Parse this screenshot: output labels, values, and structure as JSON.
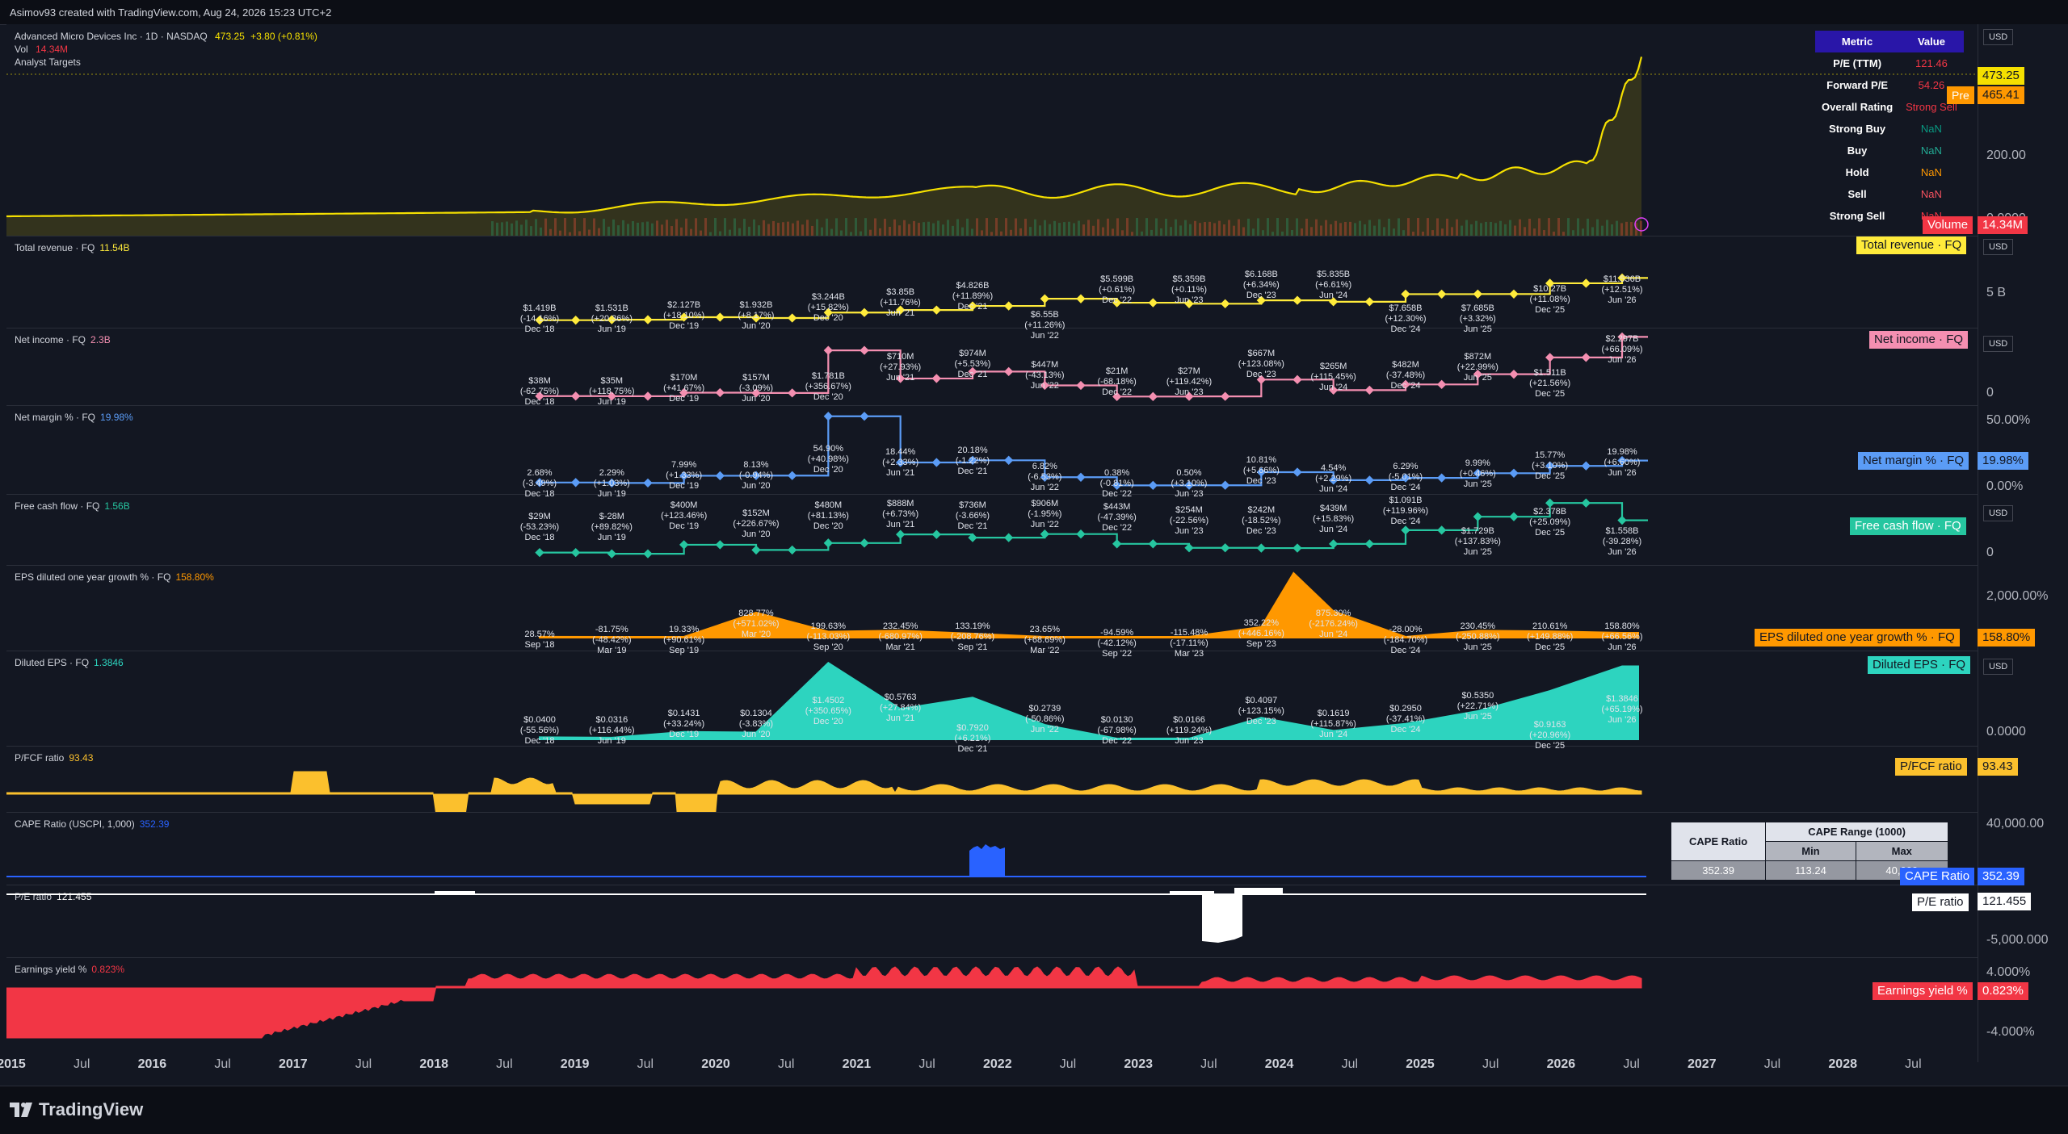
{
  "header": {
    "created_by": "Asimov93 created with TradingView.com, Aug 24, 2026 15:23 UTC+2",
    "symbol_line": "Advanced Micro Devices Inc · 1D · NASDAQ",
    "last": "473.25",
    "change": "+3.80 (+0.81%)",
    "vol_label": "Vol",
    "vol_value": "14.34M",
    "analyst": "Analyst Targets"
  },
  "metric_table": {
    "head": [
      "Metric",
      "Value"
    ],
    "rows": [
      {
        "k": "P/E (TTM)",
        "v": "121.46",
        "color": "#f23645"
      },
      {
        "k": "Forward P/E",
        "v": "54.26",
        "color": "#f23645"
      },
      {
        "k": "Overall Rating",
        "v": "Strong Sell",
        "color": "#f23645"
      },
      {
        "k": "Strong Buy",
        "v": "NaN",
        "color": "#089981"
      },
      {
        "k": "Buy",
        "v": "NaN",
        "color": "#22ab94"
      },
      {
        "k": "Hold",
        "v": "NaN",
        "color": "#ff9800"
      },
      {
        "k": "Sell",
        "v": "NaN",
        "color": "#f7525f"
      },
      {
        "k": "Strong Sell",
        "v": "NaN",
        "color": "#f23645"
      }
    ]
  },
  "cape_table": {
    "title": "CAPE Ratio",
    "range_title": "CAPE Range (1000)",
    "min_label": "Min",
    "max_label": "Max",
    "value": "352.39",
    "min": "113.24",
    "max": "40,000"
  },
  "colors": {
    "price": "#f5e000",
    "revenue": "#ffeb3b",
    "income": "#f48fb1",
    "margin": "#5b9cf6",
    "fcf": "#26c6a0",
    "eps_growth": "#ff9800",
    "diluted": "#2dd4bf",
    "pfcf": "#fbc02d",
    "cape": "#2962ff",
    "pe": "#ffffff",
    "ey": "#f23645"
  },
  "price_pane": {
    "usd": "USD",
    "scale": [
      "200.00",
      "0.0000"
    ],
    "last_tag": "473.25",
    "pre_label": "Pre",
    "pre_value": "465.41",
    "volume_label": "Volume",
    "volume_value": "14.34M"
  },
  "panes": {
    "revenue": {
      "title": "Total revenue · FQ",
      "value": "11.54B",
      "tag": "Total revenue · FQ",
      "usd": "USD",
      "scale": "5 B"
    },
    "income": {
      "title": "Net income · FQ",
      "value": "2.3B",
      "tag": "Net income · FQ",
      "usd": "USD",
      "scale": "0"
    },
    "margin": {
      "title": "Net margin % · FQ",
      "value": "19.98%",
      "tag": "Net margin % · FQ",
      "tag_value": "19.98%",
      "scale": [
        "50.00%",
        "0.00%"
      ]
    },
    "fcf": {
      "title": "Free cash flow · FQ",
      "value": "1.56B",
      "tag": "Free cash flow · FQ",
      "usd": "USD",
      "scale": "0"
    },
    "eps_growth": {
      "title": "EPS diluted one year growth % · FQ",
      "value": "158.80%",
      "tag": "EPS diluted one year growth % · FQ",
      "tag_value": "158.80%",
      "scale": "2,000.00%"
    },
    "diluted": {
      "title": "Diluted EPS · FQ",
      "value": "1.3846",
      "tag": "Diluted EPS · FQ",
      "usd": "USD",
      "scale": "0.0000"
    },
    "pfcf": {
      "title": "P/FCF ratio",
      "value": "93.43",
      "tag": "P/FCF ratio",
      "tag_value": "93.43"
    },
    "cape": {
      "title": "CAPE Ratio (USCPI, 1,000)",
      "value": "352.39",
      "tag": "CAPE Ratio",
      "tag_value": "352.39",
      "scale": "40,000.00"
    },
    "pe": {
      "title": "P/E ratio",
      "value": "121.455",
      "tag": "P/E ratio",
      "tag_value": "121.455",
      "scale": "-5,000.000"
    },
    "ey": {
      "title": "Earnings yield %",
      "value": "0.823%",
      "tag": "Earnings yield %",
      "tag_value": "0.823%",
      "scale": [
        "4.000%",
        "-4.000%"
      ]
    }
  },
  "revenue_ann": [
    [
      "$1.419B",
      "(-14.16%)",
      "Dec '18"
    ],
    [
      "$1.531B",
      "(+20.36%)",
      "Jun '19"
    ],
    [
      "$2.127B",
      "(+18.10%)",
      "Dec '19"
    ],
    [
      "$1.932B",
      "(+8.17%)",
      "Jun '20"
    ],
    [
      "$3.244B",
      "(+15.82%)",
      "Dec '20"
    ],
    [
      "$3.85B",
      "(+11.76%)",
      "Jun '21"
    ],
    [
      "$4.826B",
      "(+11.89%)",
      "Dec '21"
    ],
    [
      "$6.55B",
      "(+11.26%)",
      "Jun '22"
    ],
    [
      "$5.599B",
      "(+0.61%)",
      "Dec '22"
    ],
    [
      "$5.359B",
      "(+0.11%)",
      "Jun '23"
    ],
    [
      "$6.168B",
      "(+6.34%)",
      "Dec '23"
    ],
    [
      "$5.835B",
      "(+6.61%)",
      "Jun '24"
    ],
    [
      "$7.658B",
      "(+12.30%)",
      "Dec '24"
    ],
    [
      "$7.685B",
      "(+3.32%)",
      "Jun '25"
    ],
    [
      "$10.27B",
      "(+11.08%)",
      "Dec '25"
    ],
    [
      "$11.536B",
      "(+12.51%)",
      "Jun '26"
    ]
  ],
  "income_ann": [
    [
      "$38M",
      "(-62.75%)",
      "Dec '18"
    ],
    [
      "$35M",
      "(+118.75%)",
      "Jun '19"
    ],
    [
      "$170M",
      "(+41.67%)",
      "Dec '19"
    ],
    [
      "$157M",
      "(-3.09%)",
      "Jun '20"
    ],
    [
      "$1.781B",
      "(+356.67%)",
      "Dec '20"
    ],
    [
      "$710M",
      "(+27.93%)",
      "Jun '21"
    ],
    [
      "$974M",
      "(+5.53%)",
      "Dec '21"
    ],
    [
      "$447M",
      "(-43.13%)",
      "Jun '22"
    ],
    [
      "$21M",
      "(-68.18%)",
      "Dec '22"
    ],
    [
      "$27M",
      "(+119.42%)",
      "Jun '23"
    ],
    [
      "$667M",
      "(+123.08%)",
      "Dec '23"
    ],
    [
      "$265M",
      "(+115.45%)",
      "Jun '24"
    ],
    [
      "$482M",
      "(-37.48%)",
      "Dec '24"
    ],
    [
      "$872M",
      "(+22.99%)",
      "Jun '25"
    ],
    [
      "$1.511B",
      "(+21.56%)",
      "Dec '25"
    ],
    [
      "$2.297B",
      "(+66.09%)",
      "Jun '26"
    ]
  ],
  "margin_ann": [
    [
      "2.68%",
      "(-3.49%)",
      "Dec '18"
    ],
    [
      "2.29%",
      "(+1.03%)",
      "Jun '19"
    ],
    [
      "7.99%",
      "(+1.33%)",
      "Dec '19"
    ],
    [
      "8.13%",
      "(-0.94%)",
      "Jun '20"
    ],
    [
      "54.90%",
      "(+40.98%)",
      "Dec '20"
    ],
    [
      "18.44%",
      "(+2.33%)",
      "Jun '21"
    ],
    [
      "20.18%",
      "(-1.22%)",
      "Dec '21"
    ],
    [
      "6.82%",
      "(-6.53%)",
      "Jun '22"
    ],
    [
      "0.38%",
      "(-0.81%)",
      "Dec '22"
    ],
    [
      "0.50%",
      "(+3.10%)",
      "Jun '23"
    ],
    [
      "10.81%",
      "(+5.66%)",
      "Dec '23"
    ],
    [
      "4.54%",
      "(+2.29%)",
      "Jun '24"
    ],
    [
      "6.29%",
      "(-5.01%)",
      "Dec '24"
    ],
    [
      "9.99%",
      "(+0.46%)",
      "Jun '25"
    ],
    [
      "15.77%",
      "(+3.10%)",
      "Dec '25"
    ],
    [
      "19.98%",
      "(+6.60%)",
      "Jun '26"
    ]
  ],
  "fcf_ann": [
    [
      "$29M",
      "(-53.23%)",
      "Dec '18"
    ],
    [
      "$-28M",
      "(+89.82%)",
      "Jun '19"
    ],
    [
      "$400M",
      "(+123.46%)",
      "Dec '19"
    ],
    [
      "$152M",
      "(+226.67%)",
      "Jun '20"
    ],
    [
      "$480M",
      "(+81.13%)",
      "Dec '20"
    ],
    [
      "$888M",
      "(+6.73%)",
      "Jun '21"
    ],
    [
      "$736M",
      "(-3.66%)",
      "Dec '21"
    ],
    [
      "$906M",
      "(-1.95%)",
      "Jun '22"
    ],
    [
      "$443M",
      "(-47.39%)",
      "Dec '22"
    ],
    [
      "$254M",
      "(-22.56%)",
      "Jun '23"
    ],
    [
      "$242M",
      "(-18.52%)",
      "Dec '23"
    ],
    [
      "$439M",
      "(+15.83%)",
      "Jun '24"
    ],
    [
      "$1.091B",
      "(+119.96%)",
      "Dec '24"
    ],
    [
      "$1.729B",
      "(+137.83%)",
      "Jun '25"
    ],
    [
      "$2.378B",
      "(+25.09%)",
      "Dec '25"
    ],
    [
      "$1.558B",
      "(-39.28%)",
      "Jun '26"
    ]
  ],
  "eps_growth_ann": [
    [
      "28.57%",
      "",
      "Sep '18"
    ],
    [
      "-81.75%",
      "(-48.42%)",
      "Mar '19"
    ],
    [
      "19.33%",
      "(+90.61%)",
      "Sep '19"
    ],
    [
      "828.77%",
      "(+571.02%)",
      "Mar '20"
    ],
    [
      "199.63%",
      "(-113.03%)",
      "Sep '20"
    ],
    [
      "232.45%",
      "(-680.97%)",
      "Mar '21"
    ],
    [
      "133.19%",
      "(-208.76%)",
      "Sep '21"
    ],
    [
      "23.65%",
      "(+68.69%)",
      "Mar '22"
    ],
    [
      "-94.59%",
      "(-42.12%)",
      "Sep '22"
    ],
    [
      "-115.48%",
      "(-17.11%)",
      "Mar '23"
    ],
    [
      "352.22%",
      "(+446.16%)",
      "Sep '23"
    ],
    [
      "875.30%",
      "(-2176.24%)",
      "Jun '24"
    ],
    [
      "-28.00%",
      "(-184.70%)",
      "Dec '24"
    ],
    [
      "230.45%",
      "(-250.88%)",
      "Jun '25"
    ],
    [
      "210.61%",
      "(+149.88%)",
      "Dec '25"
    ],
    [
      "158.80%",
      "(+66.56%)",
      "Jun '26"
    ]
  ],
  "diluted_ann": [
    [
      "$0.0400",
      "(-55.56%)",
      "Dec '18"
    ],
    [
      "$0.0316",
      "(+116.44%)",
      "Jun '19"
    ],
    [
      "$0.1431",
      "(+33.24%)",
      "Dec '19"
    ],
    [
      "$0.1304",
      "(-3.83%)",
      "Jun '20"
    ],
    [
      "$1.4502",
      "(+350.65%)",
      "Dec '20"
    ],
    [
      "$0.5763",
      "(+27.84%)",
      "Jun '21"
    ],
    [
      "$0.7920",
      "(+6.21%)",
      "Dec '21"
    ],
    [
      "$0.2739",
      "(-50.86%)",
      "Jun '22"
    ],
    [
      "$0.0130",
      "(-67.98%)",
      "Dec '22"
    ],
    [
      "$0.0166",
      "(+119.24%)",
      "Jun '23"
    ],
    [
      "$0.4097",
      "(+123.15%)",
      "Dec '23"
    ],
    [
      "$0.1619",
      "(+115.87%)",
      "Jun '24"
    ],
    [
      "$0.2950",
      "(-37.41%)",
      "Dec '24"
    ],
    [
      "$0.5350",
      "(+22.71%)",
      "Jun '25"
    ],
    [
      "$0.9163",
      "(+20.96%)",
      "Dec '25"
    ],
    [
      "$1.3846",
      "(+65.19%)",
      "Jun '26"
    ]
  ],
  "time_axis": [
    {
      "t": "2015",
      "y": true
    },
    {
      "t": "Jul",
      "y": false
    },
    {
      "t": "2016",
      "y": true
    },
    {
      "t": "Jul",
      "y": false
    },
    {
      "t": "2017",
      "y": true
    },
    {
      "t": "Jul",
      "y": false
    },
    {
      "t": "2018",
      "y": true
    },
    {
      "t": "Jul",
      "y": false
    },
    {
      "t": "2019",
      "y": true
    },
    {
      "t": "Jul",
      "y": false
    },
    {
      "t": "2020",
      "y": true
    },
    {
      "t": "Jul",
      "y": false
    },
    {
      "t": "2021",
      "y": true
    },
    {
      "t": "Jul",
      "y": false
    },
    {
      "t": "2022",
      "y": true
    },
    {
      "t": "Jul",
      "y": false
    },
    {
      "t": "2023",
      "y": true
    },
    {
      "t": "Jul",
      "y": false
    },
    {
      "t": "2024",
      "y": true
    },
    {
      "t": "Jul",
      "y": false
    },
    {
      "t": "2025",
      "y": true
    },
    {
      "t": "Jul",
      "y": false
    },
    {
      "t": "2026",
      "y": true
    },
    {
      "t": "Jul",
      "y": false
    },
    {
      "t": "2027",
      "y": true
    },
    {
      "t": "Jul",
      "y": false
    },
    {
      "t": "2028",
      "y": true
    },
    {
      "t": "Jul",
      "y": false
    }
  ],
  "footer": {
    "brand": "TradingView"
  }
}
